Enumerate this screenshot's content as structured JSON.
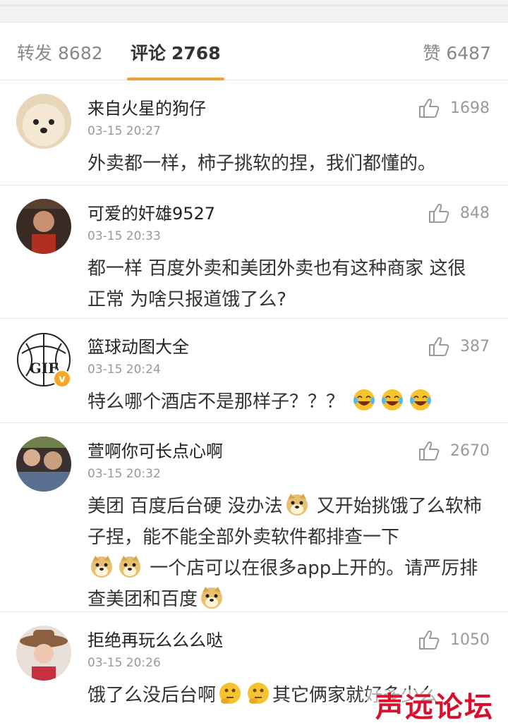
{
  "tabs": {
    "repost_label": "转发",
    "repost_count": "8682",
    "comments_label": "评论",
    "comments_count": "2768",
    "likes_label": "赞",
    "likes_count": "6487"
  },
  "comments": [
    {
      "username": "来自火星的狗仔",
      "time": "03-15 20:27",
      "likes": "1698",
      "text": "外卖都一样，柿子挑软的捏，我们都懂的。"
    },
    {
      "username": "可爱的奸雄9527",
      "time": "03-15 20:33",
      "likes": "848",
      "text": "都一样 百度外卖和美团外卖也有这种商家 这很正常 为啥只报道饿了么?"
    },
    {
      "username": "篮球动图大全",
      "time": "03-15 20:24",
      "likes": "387",
      "text": "特么哪个酒店不是那样子？？？",
      "emoji": [
        "laughing-tears-emoji",
        "laughing-tears-emoji",
        "laughing-tears-emoji"
      ],
      "avatar_text": "GIF",
      "verified_badge": "v"
    },
    {
      "username": "萱啊你可长点心啊",
      "time": "03-15 20:32",
      "likes": "2670",
      "text_a": "美团 百度后台硬 没办法",
      "text_b": " 又开始挑饿了么软柿子捏，能不能全部外卖软件都排查一下",
      "text_c": " 一个店可以在很多app上开的。请严厉排查美团和百度",
      "emoji": [
        "doge-emoji",
        "doge-emoji",
        "doge-emoji",
        "doge-emoji"
      ]
    },
    {
      "username": "拒绝再玩么么么哒",
      "time": "03-15 20:26",
      "likes": "1050",
      "text_a": "饿了么没后台啊",
      "text_b": "其它俩家就好多少么",
      "emoji": [
        "thinking-emoji",
        "thinking-emoji"
      ]
    }
  ],
  "watermark": "声远论坛",
  "colors": {
    "accent": "#f0a030",
    "watermark": "#d8102d",
    "secondary_text": "#999999"
  }
}
